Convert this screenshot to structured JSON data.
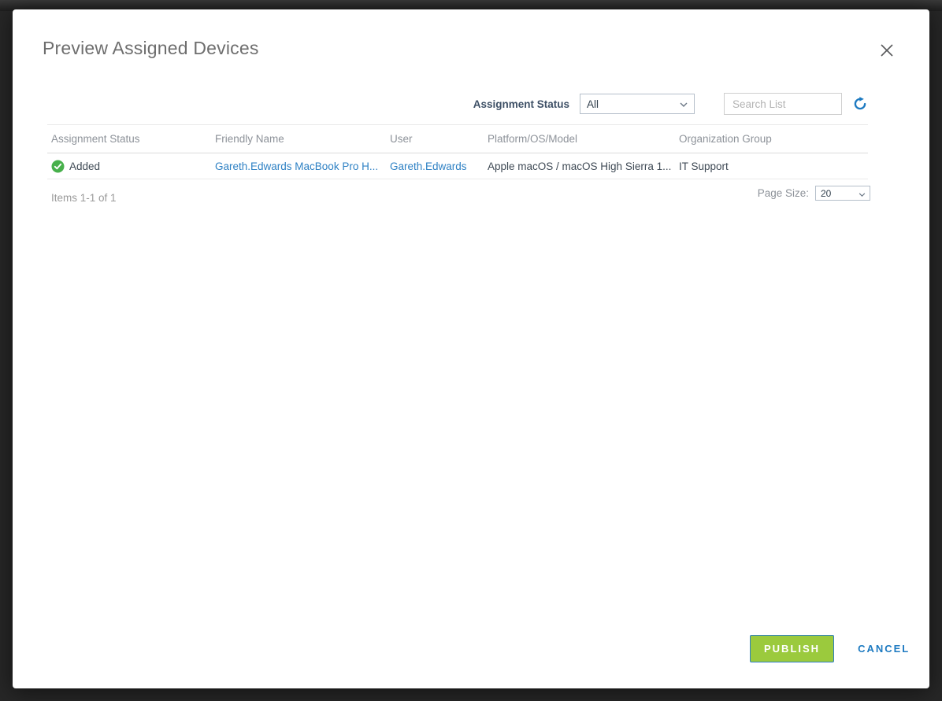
{
  "modal": {
    "title": "Preview Assigned Devices"
  },
  "filters": {
    "assignment_status_label": "Assignment Status",
    "assignment_status_value": "All",
    "search_placeholder": "Search List"
  },
  "table": {
    "columns": [
      "Assignment Status",
      "Friendly Name",
      "User",
      "Platform/OS/Model",
      "Organization Group"
    ],
    "rows": [
      {
        "status": "Added",
        "friendly_name": "Gareth.Edwards MacBook Pro H...",
        "user": "Gareth.Edwards",
        "platform": "Apple macOS / macOS High Sierra 1...",
        "org_group": "IT Support"
      }
    ]
  },
  "pagination": {
    "items_text": "Items 1-1 of 1",
    "page_size_label": "Page Size:",
    "page_size_value": "20"
  },
  "footer": {
    "publish_label": "PUBLISH",
    "cancel_label": "CANCEL"
  },
  "icons": {
    "close": "x-cross",
    "refresh": "clockwise-circular-arrow",
    "status_added": "green-check-circle",
    "select_chevron": "chevron-down"
  },
  "colors": {
    "publish_green": "#9bca3d",
    "link_blue": "#2e81c4",
    "cancel_blue": "#1d7ac1",
    "status_green": "#47b04b",
    "overlay_dark": "#272727"
  }
}
